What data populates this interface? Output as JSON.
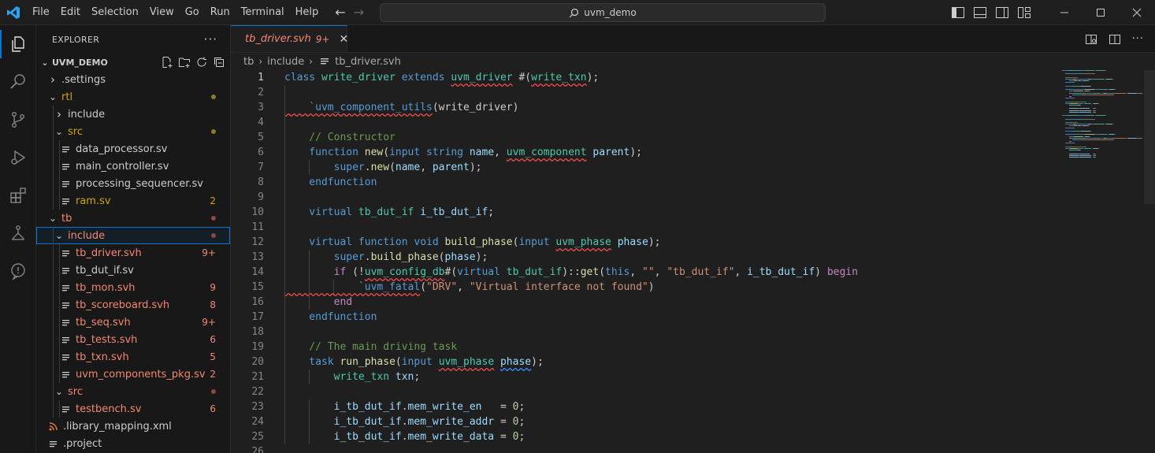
{
  "titlebar": {
    "menu": [
      "File",
      "Edit",
      "Selection",
      "View",
      "Go",
      "Run",
      "Terminal",
      "Help"
    ],
    "search_text": "uvm_demo"
  },
  "explorer": {
    "header": "EXPLORER",
    "more": "···",
    "root": "UVM_DEMO",
    "items": [
      {
        "label": ".settings",
        "depth": 1,
        "kind": "folder",
        "open": false,
        "color": "normal"
      },
      {
        "label": "rtl",
        "depth": 1,
        "kind": "folder",
        "open": true,
        "color": "warn",
        "dot": "#8a7a2a"
      },
      {
        "label": "include",
        "depth": 2,
        "kind": "folder",
        "open": false,
        "color": "normal"
      },
      {
        "label": "src",
        "depth": 2,
        "kind": "folder",
        "open": true,
        "color": "warn",
        "dot": "#8a7a2a"
      },
      {
        "label": "data_processor.sv",
        "depth": 3,
        "kind": "file",
        "color": "normal"
      },
      {
        "label": "main_controller.sv",
        "depth": 3,
        "kind": "file",
        "color": "normal"
      },
      {
        "label": "processing_sequencer.sv",
        "depth": 3,
        "kind": "file",
        "color": "normal"
      },
      {
        "label": "ram.sv",
        "depth": 3,
        "kind": "file",
        "color": "warn",
        "badge": "2"
      },
      {
        "label": "tb",
        "depth": 1,
        "kind": "folder",
        "open": true,
        "color": "err",
        "dot": "#8a4a40"
      },
      {
        "label": "include",
        "depth": 2,
        "kind": "folder",
        "open": true,
        "color": "err",
        "dot": "#8a4a40",
        "selected": true
      },
      {
        "label": "tb_driver.svh",
        "depth": 3,
        "kind": "file",
        "color": "err",
        "badge": "9+"
      },
      {
        "label": "tb_dut_if.sv",
        "depth": 3,
        "kind": "file",
        "color": "normal"
      },
      {
        "label": "tb_mon.svh",
        "depth": 3,
        "kind": "file",
        "color": "err",
        "badge": "9"
      },
      {
        "label": "tb_scoreboard.svh",
        "depth": 3,
        "kind": "file",
        "color": "err",
        "badge": "8"
      },
      {
        "label": "tb_seq.svh",
        "depth": 3,
        "kind": "file",
        "color": "err",
        "badge": "9+"
      },
      {
        "label": "tb_tests.svh",
        "depth": 3,
        "kind": "file",
        "color": "err",
        "badge": "6"
      },
      {
        "label": "tb_txn.svh",
        "depth": 3,
        "kind": "file",
        "color": "err",
        "badge": "5"
      },
      {
        "label": "uvm_components_pkg.sv",
        "depth": 3,
        "kind": "file",
        "color": "err",
        "badge": "2"
      },
      {
        "label": "src",
        "depth": 2,
        "kind": "folder",
        "open": true,
        "color": "err",
        "dot": "#8a4a40"
      },
      {
        "label": "testbench.sv",
        "depth": 3,
        "kind": "file",
        "color": "err",
        "badge": "6"
      },
      {
        "label": ".library_mapping.xml",
        "depth": 1,
        "kind": "rss",
        "color": "normal"
      },
      {
        "label": ".project",
        "depth": 1,
        "kind": "file",
        "color": "normal"
      }
    ]
  },
  "editor": {
    "tab": {
      "label": "tb_driver.svh",
      "badge": "9+"
    },
    "breadcrumb": [
      "tb",
      "include",
      "tb_driver.svh"
    ],
    "lines": [
      [
        [
          "kw",
          "class "
        ],
        [
          "ty",
          "write_driver "
        ],
        [
          "kw",
          "extends "
        ],
        [
          "ty sq",
          "uvm_driver"
        ],
        [
          "pl",
          " #("
        ],
        [
          "ty sq",
          "write_txn"
        ],
        [
          "pl",
          ");"
        ]
      ],
      [],
      [
        [
          "mac sq",
          "    `uvm_component_utils"
        ],
        [
          "pl",
          "(write_driver)"
        ]
      ],
      [],
      [
        [
          "cm",
          "    // Constructor"
        ]
      ],
      [
        [
          "kw",
          "    function "
        ],
        [
          "fn",
          "new"
        ],
        [
          "pl",
          "("
        ],
        [
          "kw",
          "input "
        ],
        [
          "kw",
          "string "
        ],
        [
          "vr",
          "name"
        ],
        [
          "pl",
          ", "
        ],
        [
          "ty sq",
          "uvm_component"
        ],
        [
          "pl",
          " "
        ],
        [
          "vr",
          "parent"
        ],
        [
          "pl",
          ");"
        ]
      ],
      [
        [
          "kw",
          "        super"
        ],
        [
          "pl",
          "."
        ],
        [
          "fn",
          "new"
        ],
        [
          "pl",
          "("
        ],
        [
          "vr",
          "name"
        ],
        [
          "pl",
          ", "
        ],
        [
          "vr",
          "parent"
        ],
        [
          "pl",
          ");"
        ]
      ],
      [
        [
          "kw",
          "    endfunction"
        ]
      ],
      [],
      [
        [
          "kw",
          "    virtual "
        ],
        [
          "ty",
          "tb_dut_if "
        ],
        [
          "vr",
          "i_tb_dut_if"
        ],
        [
          "pl",
          ";"
        ]
      ],
      [],
      [
        [
          "kw",
          "    virtual "
        ],
        [
          "kw",
          "function "
        ],
        [
          "kw",
          "void "
        ],
        [
          "fn",
          "build_phase"
        ],
        [
          "pl",
          "("
        ],
        [
          "kw",
          "input "
        ],
        [
          "ty sq",
          "uvm_phase"
        ],
        [
          "pl",
          " "
        ],
        [
          "vr",
          "phase"
        ],
        [
          "pl",
          ");"
        ]
      ],
      [
        [
          "kw",
          "        super"
        ],
        [
          "pl",
          "."
        ],
        [
          "fn",
          "build_phase"
        ],
        [
          "pl",
          "("
        ],
        [
          "vr",
          "phase"
        ],
        [
          "pl",
          ");"
        ]
      ],
      [
        [
          "ctl",
          "        if "
        ],
        [
          "pl",
          "(!"
        ],
        [
          "ty sq",
          "uvm_config_db"
        ],
        [
          "pl",
          "#("
        ],
        [
          "kw",
          "virtual "
        ],
        [
          "ty",
          "tb_dut_if"
        ],
        [
          "pl",
          ")::"
        ],
        [
          "fn",
          "get"
        ],
        [
          "pl",
          "("
        ],
        [
          "kw",
          "this"
        ],
        [
          "pl",
          ", "
        ],
        [
          "str",
          "\"\""
        ],
        [
          "pl",
          ", "
        ],
        [
          "str",
          "\"tb_dut_if\""
        ],
        [
          "pl",
          ", "
        ],
        [
          "vr",
          "i_tb_dut_if"
        ],
        [
          "pl",
          ") "
        ],
        [
          "ctl",
          "begin"
        ]
      ],
      [
        [
          "mac sq",
          "            `uvm_fatal"
        ],
        [
          "pl",
          "("
        ],
        [
          "str",
          "\"DRV\""
        ],
        [
          "pl",
          ", "
        ],
        [
          "str",
          "\"Virtual interface not found\""
        ],
        [
          "pl",
          ")"
        ]
      ],
      [
        [
          "ctl",
          "        end"
        ]
      ],
      [
        [
          "kw",
          "    endfunction"
        ]
      ],
      [],
      [
        [
          "cm",
          "    // The main driving task"
        ]
      ],
      [
        [
          "kw",
          "    task "
        ],
        [
          "fn",
          "run_phase"
        ],
        [
          "pl",
          "("
        ],
        [
          "kw",
          "input "
        ],
        [
          "ty sq",
          "uvm_phase"
        ],
        [
          "pl",
          " "
        ],
        [
          "vr sqb",
          "phase"
        ],
        [
          "pl",
          ");"
        ]
      ],
      [
        [
          "ty",
          "        write_txn "
        ],
        [
          "vr",
          "txn"
        ],
        [
          "pl",
          ";"
        ]
      ],
      [],
      [
        [
          "vr",
          "        i_tb_dut_if"
        ],
        [
          "pl",
          "."
        ],
        [
          "vr",
          "mem_write_en"
        ],
        [
          "pl",
          "   = "
        ],
        [
          "num",
          "0"
        ],
        [
          "pl",
          ";"
        ]
      ],
      [
        [
          "vr",
          "        i_tb_dut_if"
        ],
        [
          "pl",
          "."
        ],
        [
          "vr",
          "mem_write_addr"
        ],
        [
          "pl",
          " = "
        ],
        [
          "num",
          "0"
        ],
        [
          "pl",
          ";"
        ]
      ],
      [
        [
          "vr",
          "        i_tb_dut_if"
        ],
        [
          "pl",
          "."
        ],
        [
          "vr",
          "mem_write_data"
        ],
        [
          "pl",
          " = "
        ],
        [
          "num",
          "0"
        ],
        [
          "pl",
          ";"
        ]
      ],
      []
    ],
    "current_line": 1
  },
  "colors": {
    "accent": "#0078d4",
    "error": "#f48771",
    "warning": "#cca700"
  }
}
